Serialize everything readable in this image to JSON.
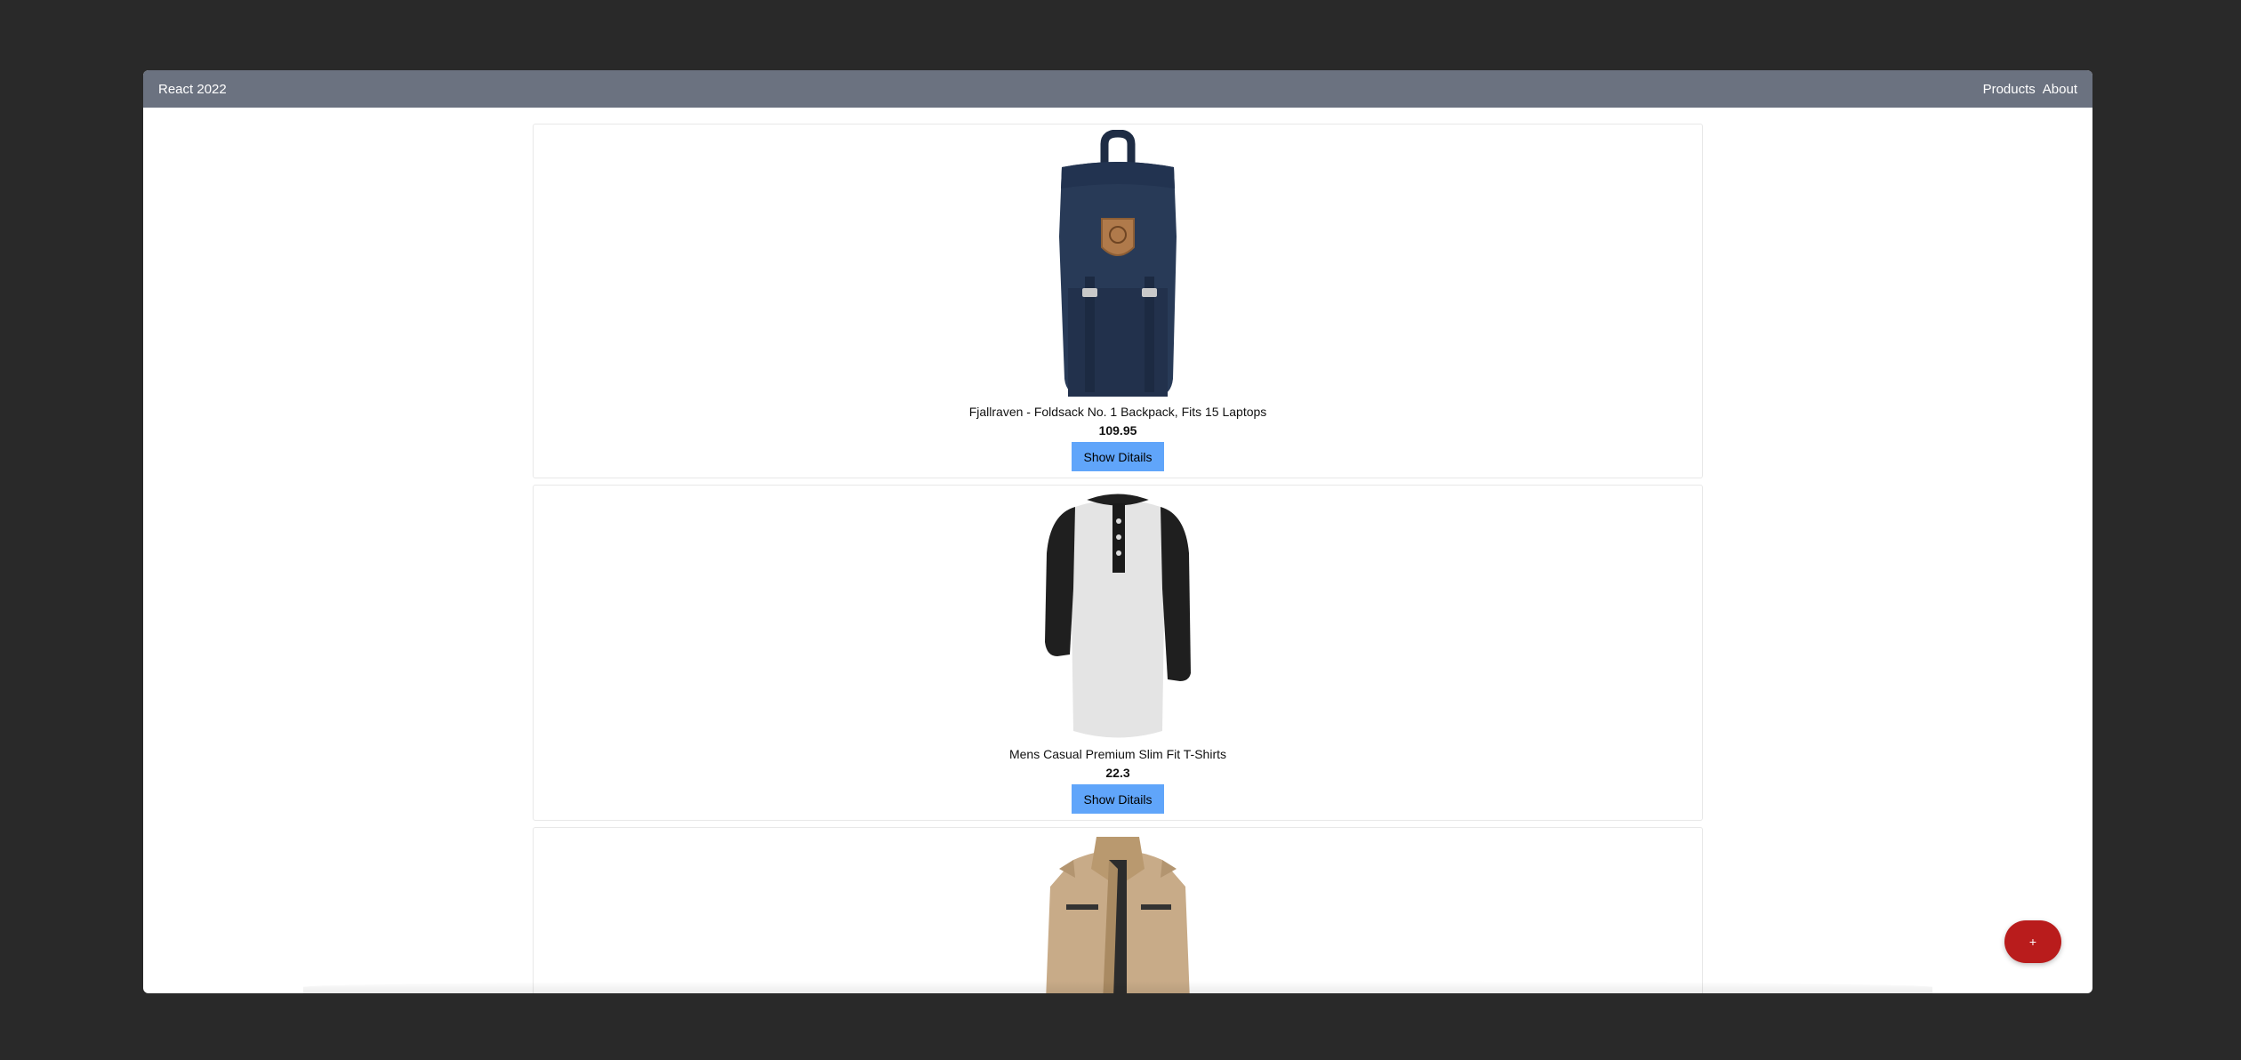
{
  "navbar": {
    "brand": "React 2022",
    "links": [
      "Products",
      "About"
    ]
  },
  "products": [
    {
      "title": "Fjallraven - Foldsack No. 1 Backpack, Fits 15 Laptops",
      "price": "109.95",
      "button_label": "Show Ditails",
      "image": "navy backpack"
    },
    {
      "title": "Mens Casual Premium Slim Fit T-Shirts",
      "price": "22.3",
      "button_label": "Show Ditails",
      "image": "raglan henley shirt"
    },
    {
      "image": "beige jacket"
    }
  ],
  "fab": {
    "label": "+"
  },
  "colors": {
    "navbar": "#6b7280",
    "button": "#60a5fa",
    "fab": "#b91c1c",
    "outer_background": "#292929"
  }
}
